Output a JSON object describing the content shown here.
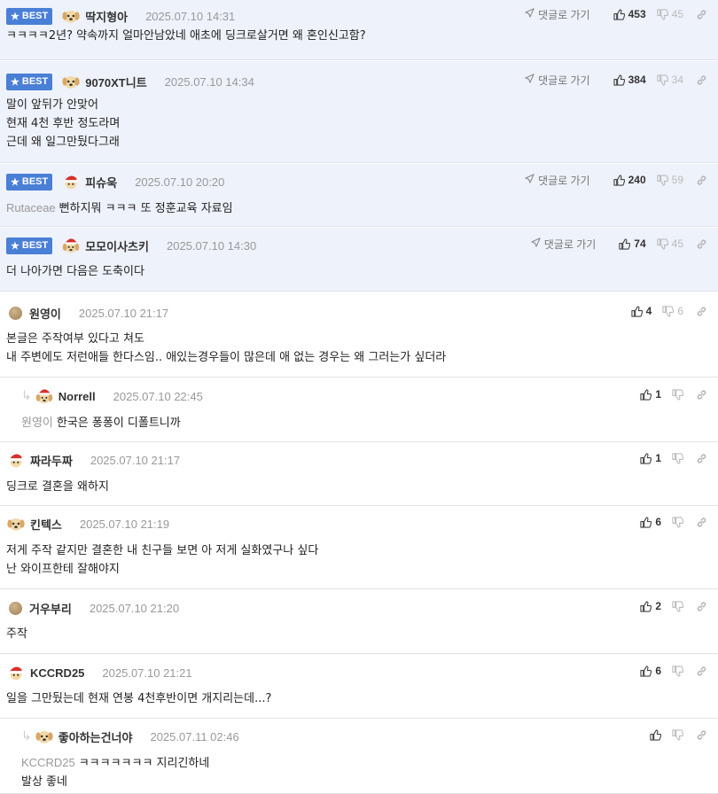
{
  "ui": {
    "best_label": "BEST",
    "goto_label": "댓글로 가기"
  },
  "comments": [
    {
      "best": true,
      "avatar": "dog-avatar",
      "nick": "딱지형아",
      "date": "2025.07.10 14:31",
      "up": "453",
      "down": "45",
      "lines": [
        "ㅋㅋㅋㅋ2년? 약속까지 얼마안남았네 애초에 딩크로살거면 왜 혼인신고함?"
      ]
    },
    {
      "best": true,
      "avatar": "dog-avatar",
      "nick": "9070XT니트",
      "date": "2025.07.10 14:34",
      "up": "384",
      "down": "34",
      "lines": [
        "말이 앞뒤가 안맞어",
        "현재 4천 후반 정도라며",
        "근데 왜 일그만뒀다그래"
      ]
    },
    {
      "best": true,
      "avatar": "santa-avatar",
      "nick": "피슈욱",
      "date": "2025.07.10 20:20",
      "up": "240",
      "down": "59",
      "mention": "Rutaceae",
      "lines": [
        "뻔하지뭐 ㅋㅋㅋ 또 정훈교육 자료임"
      ]
    },
    {
      "best": true,
      "avatar": "santa-dog-avatar",
      "nick": "모모이사츠키",
      "date": "2025.07.10 14:30",
      "up": "74",
      "down": "45",
      "lines": [
        "더 나아가면 다음은 도축이다"
      ]
    },
    {
      "best": false,
      "avatar": "dot-avatar",
      "nick": "원영이",
      "date": "2025.07.10 21:17",
      "up": "4",
      "down": "6",
      "lines": [
        "본글은 주작여부 있다고 쳐도",
        "내 주변에도 저런애들 한다스임.. 애있는경우들이 많은데 애 없는 경우는 왜 그러는가 싶더라"
      ]
    },
    {
      "best": false,
      "reply": true,
      "avatar": "santa-dog-avatar",
      "nick": "Norrell",
      "date": "2025.07.10 22:45",
      "up": "1",
      "down": "",
      "mention": "원영이",
      "lines": [
        "한국은 퐁퐁이 디폴트니까"
      ]
    },
    {
      "best": false,
      "avatar": "santa-avatar",
      "nick": "짜라두짜",
      "date": "2025.07.10 21:17",
      "up": "1",
      "down": "",
      "lines": [
        "딩크로 결혼을 왜하지"
      ]
    },
    {
      "best": false,
      "avatar": "dog-avatar",
      "nick": "킨텍스",
      "date": "2025.07.10 21:19",
      "up": "6",
      "down": "",
      "lines": [
        "저게 주작 같지만 결혼한 내 친구들 보면 아 저게 실화였구나 싶다",
        "난 와이프한테 잘해야지"
      ]
    },
    {
      "best": false,
      "avatar": "dot-avatar",
      "nick": "거우부리",
      "date": "2025.07.10 21:20",
      "up": "2",
      "down": "",
      "lines": [
        "주작"
      ]
    },
    {
      "best": false,
      "avatar": "santa-avatar",
      "nick": "KCCRD25",
      "date": "2025.07.10 21:21",
      "up": "6",
      "down": "",
      "lines": [
        "일을 그만뒀는데 현재 연봉 4천후반이면 개지리는데...?"
      ]
    },
    {
      "best": false,
      "reply": true,
      "avatar": "dog-avatar",
      "nick": "좋아하는건너야",
      "date": "2025.07.11 02:46",
      "up": "",
      "down": "",
      "mention": "KCCRD25",
      "lines": [
        "ㅋㅋㅋㅋㅋㅋㅋ 지리긴하네",
        "발상 좋네"
      ]
    }
  ]
}
